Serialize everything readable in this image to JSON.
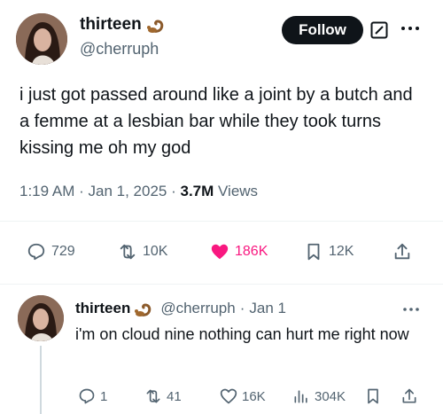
{
  "tweet": {
    "display_name": "thirteen",
    "handle": "@cherruph",
    "follow_label": "Follow",
    "text": "i just got passed around like a joint by a butch and a femme at a lesbian bar while they took turns kissing me oh my god",
    "time": "1:19 AM",
    "date": "Jan 1, 2025",
    "views_count": "3.7M",
    "views_label": "Views",
    "replies": "729",
    "reposts": "10K",
    "likes": "186K",
    "bookmarks": "12K",
    "like_color": "#f91880"
  },
  "reply": {
    "display_name": "thirteen",
    "handle": "@cherruph",
    "date": "Jan 1",
    "text": "i'm on cloud nine nothing can hurt me right now",
    "replies": "1",
    "reposts": "41",
    "likes": "16K",
    "views": "304K"
  },
  "icons": [
    "scorpion-emoji-icon",
    "grok-icon",
    "more-icon",
    "reply-icon",
    "repost-icon",
    "heart-icon",
    "bookmark-icon",
    "share-icon",
    "views-icon"
  ]
}
